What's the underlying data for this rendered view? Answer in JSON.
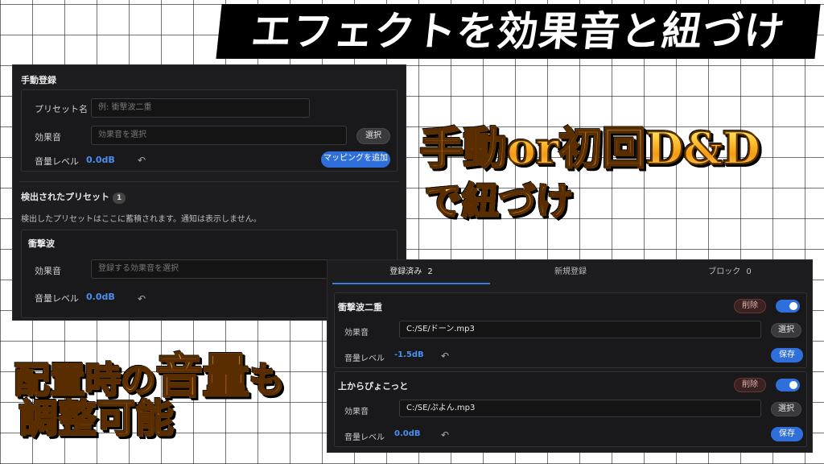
{
  "banner_title": "エフェクトを効果音と紐づけ",
  "callouts": {
    "manual_line1": "手動or初回D&D",
    "manual_line2": "で紐づけ",
    "volume_prefix": "配置時の",
    "volume_big": "音量",
    "volume_suffix": "も",
    "volume_line2": "調整可能"
  },
  "manual_panel": {
    "title": "手動登録",
    "preset_label": "プリセット名",
    "preset_placeholder": "例: 衝撃波二重",
    "sound_label": "効果音",
    "sound_placeholder": "効果音を選択",
    "select_button": "選択",
    "volume_label": "音量レベル",
    "volume_value": "0.0dB",
    "reset_icon": "↶",
    "add_mapping_button": "マッピングを追加",
    "detected_title": "検出されたプリセット",
    "detected_count": "1",
    "detected_desc": "検出したプリセットはここに蓄積されます。通知は表示しません。",
    "detected_item": {
      "name": "衝撃波",
      "sound_label": "効果音",
      "sound_placeholder": "登録する効果音を選択",
      "volume_label": "音量レベル",
      "volume_value": "0.0dB"
    }
  },
  "registry_panel": {
    "tabs": [
      {
        "label": "登録済み",
        "count": "2"
      },
      {
        "label": "新規登録",
        "count": ""
      },
      {
        "label": "ブロック",
        "count": "0"
      }
    ],
    "items": [
      {
        "name": "衝撃波二重",
        "delete_label": "削除",
        "sound_label": "効果音",
        "sound_path": "C:/SE/ドーン.mp3",
        "select_label": "選択",
        "volume_label": "音量レベル",
        "volume_value": "-1.5dB",
        "save_label": "保存"
      },
      {
        "name": "上からぴょこっと",
        "delete_label": "削除",
        "sound_label": "効果音",
        "sound_path": "C:/SE/ぷよん.mp3",
        "select_label": "選択",
        "volume_label": "音量レベル",
        "volume_value": "0.0dB",
        "save_label": "保存"
      }
    ]
  },
  "colors": {
    "accent": "#2f6fdc",
    "panel_bg": "#1d1d1f",
    "value_text": "#4a8ff0"
  }
}
